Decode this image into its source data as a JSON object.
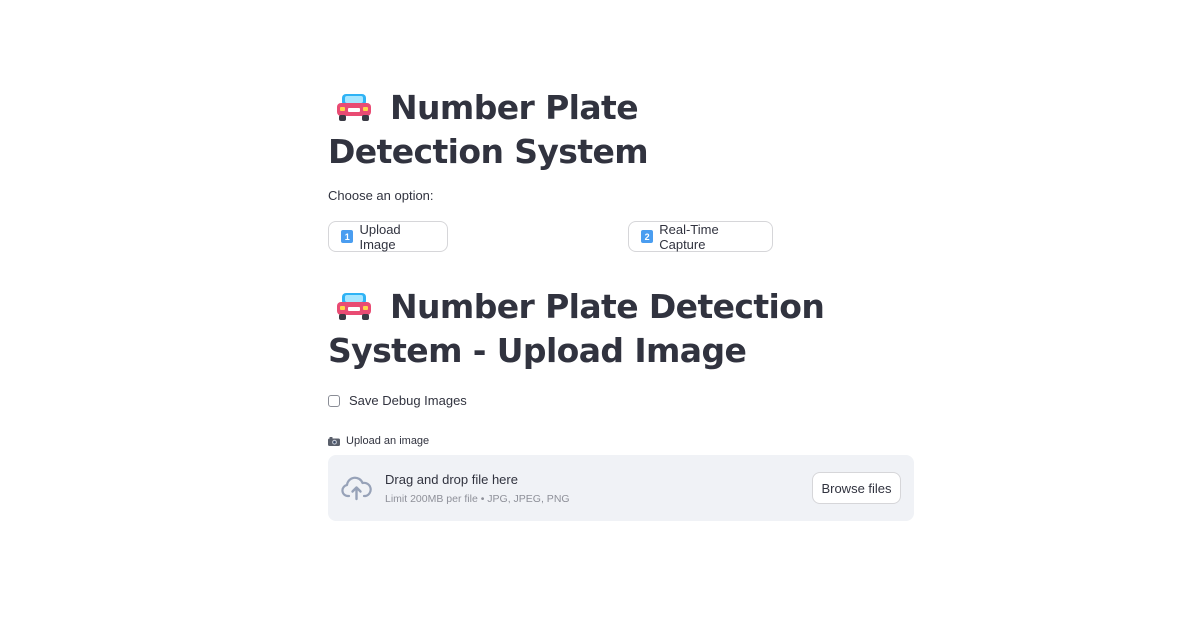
{
  "header1": {
    "emoji_icon": "car-emoji-icon",
    "title": "Number Plate Detection System"
  },
  "options": {
    "prompt": "Choose an option:",
    "upload_button": {
      "keycap": "1",
      "label": "Upload Image"
    },
    "realtime_button": {
      "keycap": "2",
      "label": "Real-Time Capture"
    }
  },
  "header2": {
    "emoji_icon": "car-emoji-icon",
    "title": "Number Plate Detection System - Upload Image"
  },
  "debug": {
    "label": "Save Debug Images",
    "checked": false
  },
  "uploader": {
    "label_icon": "camera-emoji-icon",
    "label": "Upload an image",
    "dropzone_title": "Drag and drop file here",
    "dropzone_subtitle": "Limit 200MB per file • JPG, JPEG, PNG",
    "browse_label": "Browse files",
    "icon": "cloud-upload-icon"
  },
  "colors": {
    "text": "#31333f",
    "muted": "#8e9099",
    "dropzone_bg": "#f0f2f6",
    "border": "#d6d6d9",
    "keycap": "#4a9df0",
    "cloud_icon": "#97a2b8"
  }
}
